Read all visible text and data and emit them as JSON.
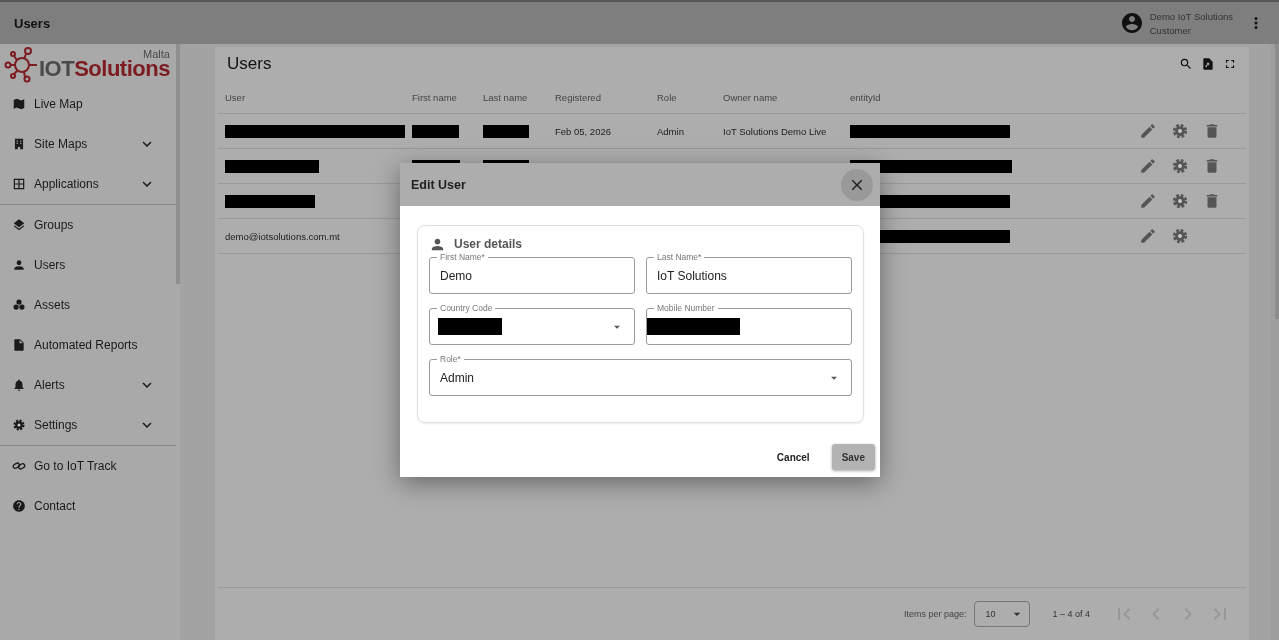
{
  "top_bar": {
    "title": "Users",
    "user_name": "Demo IoT Solutions",
    "user_role": "Customer"
  },
  "sidebar": {
    "logo": {
      "brand_left": "IOT",
      "brand_right": "Solutions",
      "region": "Malta"
    },
    "sections": [
      [
        {
          "label": "Live Map",
          "expandable": false
        },
        {
          "label": "Site Maps",
          "expandable": true
        },
        {
          "label": "Applications",
          "expandable": true
        }
      ],
      [
        {
          "label": "Groups",
          "expandable": false
        },
        {
          "label": "Users",
          "expandable": false
        },
        {
          "label": "Assets",
          "expandable": false
        },
        {
          "label": "Automated Reports",
          "expandable": false
        },
        {
          "label": "Alerts",
          "expandable": true
        },
        {
          "label": "Settings",
          "expandable": true
        }
      ],
      [
        {
          "label": "Go to IoT Track",
          "expandable": false
        },
        {
          "label": "Contact",
          "expandable": false
        }
      ]
    ]
  },
  "table": {
    "title": "Users",
    "columns": [
      "User",
      "First name",
      "Last name",
      "Registered",
      "Role",
      "Owner name",
      "entityId"
    ],
    "rows": [
      {
        "cells": [
          {
            "redacted": true
          },
          {
            "redacted": true
          },
          {
            "redacted": true
          },
          {
            "text": "Feb 05, 2026"
          },
          {
            "text": "Admin"
          },
          {
            "text": "IoT Solutions Demo Live"
          },
          {
            "redacted": true
          }
        ],
        "deletable": true
      },
      {
        "cells": [
          {
            "redacted": true
          },
          {
            "redacted": true
          },
          {
            "redacted": true
          },
          {},
          {},
          {},
          {
            "redacted": true
          }
        ],
        "deletable": true
      },
      {
        "cells": [
          {
            "redacted": true
          },
          {},
          {},
          {},
          {},
          {},
          {
            "redacted": true
          }
        ],
        "deletable": true
      },
      {
        "cells": [
          {
            "text": "demo@iotsolutions.com.mt"
          },
          {},
          {},
          {},
          {},
          {},
          {
            "redacted": true
          }
        ],
        "deletable": false
      }
    ],
    "paginator": {
      "label": "Items per page:",
      "page_size": "10",
      "range": "1 – 4 of 4",
      "nav": [
        {
          "kind": "first",
          "disabled": true
        },
        {
          "kind": "previous",
          "disabled": true
        },
        {
          "kind": "next",
          "disabled": true
        },
        {
          "kind": "last",
          "disabled": true
        }
      ]
    }
  },
  "dialog": {
    "title": "Edit User",
    "section_title": "User details",
    "fields": [
      {
        "label": "First Name*",
        "kind": "text",
        "value": "Demo"
      },
      {
        "label": "Last Name*",
        "kind": "text",
        "value": "IoT Solutions"
      },
      {
        "label": "Country Code",
        "kind": "select",
        "redacted": true
      },
      {
        "label": "Mobile Number",
        "kind": "text",
        "redacted": true
      },
      {
        "label": "Role*",
        "kind": "select",
        "value": "Admin",
        "wide": true
      }
    ],
    "buttons": [
      {
        "label": "Cancel",
        "kind": "text",
        "disabled": false
      },
      {
        "label": "Save",
        "kind": "raised",
        "disabled": true
      }
    ]
  }
}
